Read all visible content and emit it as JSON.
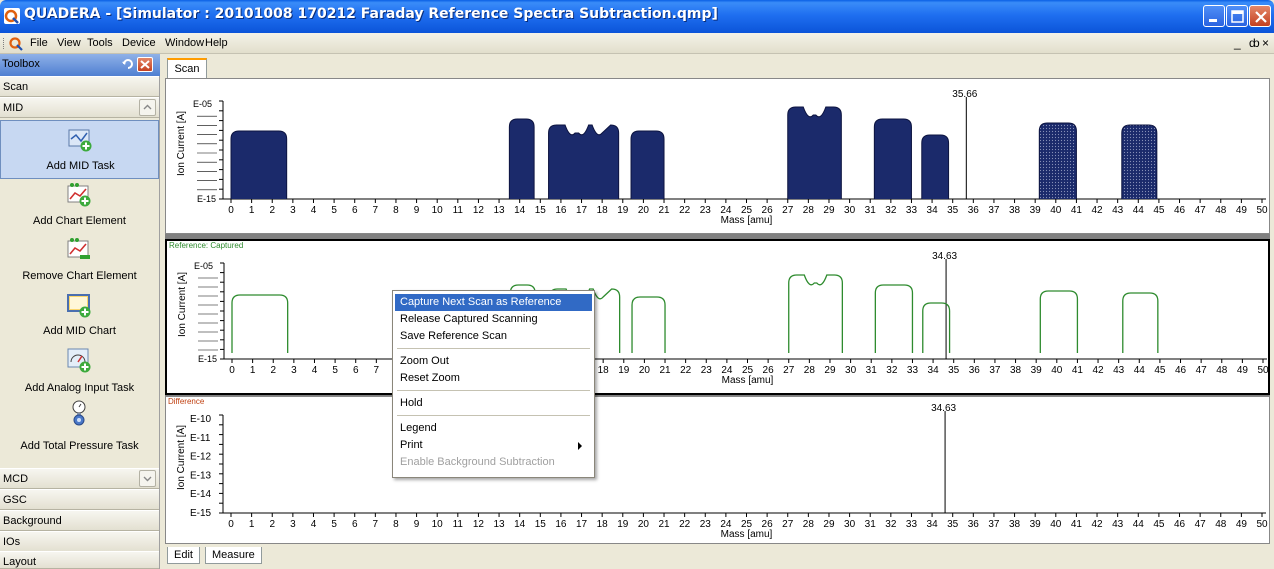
{
  "window": {
    "title": "QUADERA - [Simulator : 20101008 170212 Faraday Reference Spectra Subtraction.qmp]",
    "colors": {
      "titlebar": "#1f6ff0",
      "selection": "#316ac5",
      "series_dark": "#1b2a6b",
      "series_green": "#2e8b2e"
    }
  },
  "menu": {
    "items": [
      "File",
      "View",
      "Tools",
      "Device",
      "Window",
      "Help"
    ],
    "mdi_controls": [
      "_",
      "ȸ",
      "×"
    ]
  },
  "toolbox": {
    "title": "Toolbox",
    "categories_top": [
      "Scan",
      "MID"
    ],
    "tools": [
      {
        "label": "Add MID Task",
        "icon": "add-mid-task-icon"
      },
      {
        "label": "Add Chart Element",
        "icon": "add-chart-element-icon"
      },
      {
        "label": "Remove Chart Element",
        "icon": "remove-chart-element-icon"
      },
      {
        "label": "Add MID Chart",
        "icon": "add-mid-chart-icon"
      },
      {
        "label": "Add Analog Input Task",
        "icon": "add-analog-input-icon"
      },
      {
        "label": "Add Total Pressure Task",
        "icon": "add-total-pressure-icon"
      }
    ],
    "categories_bottom": [
      "MCD",
      "GSC",
      "Background",
      "IOs",
      "Layout"
    ]
  },
  "document": {
    "tab": "Scan",
    "bottom_tabs": [
      "Edit",
      "Measure"
    ]
  },
  "chart_data": [
    {
      "type": "area",
      "title": "",
      "xlabel": "Mass [amu]",
      "ylabel": "Ion Current [A]",
      "xlim": [
        -0.5,
        50
      ],
      "cursor_label": "35.66",
      "cursor_x": 35.66,
      "series": [
        {
          "peaks": [
            [
              0,
              2.7
            ],
            [
              13.5,
              14.7
            ],
            [
              15.4,
              18.8
            ],
            [
              19.4,
              21
            ],
            [
              27,
              29.6
            ],
            [
              31.2,
              33
            ],
            [
              33.5,
              34.8
            ],
            [
              39.2,
              41
            ],
            [
              43.2,
              44.9
            ]
          ]
        }
      ]
    },
    {
      "type": "line",
      "label": "Reference: Captured",
      "xlabel": "Mass [amu]",
      "ylabel": "Ion Current [A]",
      "xlim": [
        -0.5,
        50
      ],
      "cursor_label": "34.63",
      "cursor_x": 34.63,
      "series": [
        {
          "peaks": [
            [
              0,
              2.7
            ],
            [
              13.5,
              14.7
            ],
            [
              15.4,
              18.8
            ],
            [
              19.4,
              21
            ],
            [
              27,
              29.6
            ],
            [
              31.2,
              33
            ],
            [
              33.5,
              34.8
            ],
            [
              39.2,
              41
            ],
            [
              43.2,
              44.9
            ]
          ]
        }
      ]
    },
    {
      "type": "line",
      "label": "Difference",
      "xlabel": "Mass [amu]",
      "ylabel": "Ion Current [A]",
      "xlim": [
        -0.5,
        50
      ],
      "ytick_labels": [
        "E-10",
        "E-11",
        "E-12",
        "E-13",
        "E-14",
        "E-15"
      ],
      "cursor_label": "34.63",
      "cursor_x": 34.63
    }
  ],
  "x_ticks": [
    "0",
    "1",
    "2",
    "3",
    "4",
    "5",
    "6",
    "7",
    "8",
    "9",
    "10",
    "11",
    "12",
    "13",
    "14",
    "15",
    "16",
    "17",
    "18",
    "19",
    "20",
    "21",
    "22",
    "23",
    "24",
    "25",
    "26",
    "27",
    "28",
    "29",
    "30",
    "31",
    "32",
    "33",
    "34",
    "35",
    "36",
    "37",
    "38",
    "39",
    "40",
    "41",
    "42",
    "43",
    "44",
    "45",
    "46",
    "47",
    "48",
    "49",
    "50"
  ],
  "context_menu": {
    "items": [
      {
        "label": "Capture Next Scan as Reference",
        "state": "highlighted"
      },
      {
        "label": "Release Captured Scanning",
        "state": "normal"
      },
      {
        "label": "Save Reference Scan",
        "state": "normal"
      },
      {
        "sep": true
      },
      {
        "label": "Zoom Out",
        "state": "normal"
      },
      {
        "label": "Reset Zoom",
        "state": "normal"
      },
      {
        "sep": true
      },
      {
        "label": "Hold",
        "state": "normal"
      },
      {
        "sep": true
      },
      {
        "label": "Legend",
        "state": "normal"
      },
      {
        "label": "Print",
        "state": "submenu"
      },
      {
        "label": "Enable Background Subtraction",
        "state": "disabled"
      }
    ]
  }
}
